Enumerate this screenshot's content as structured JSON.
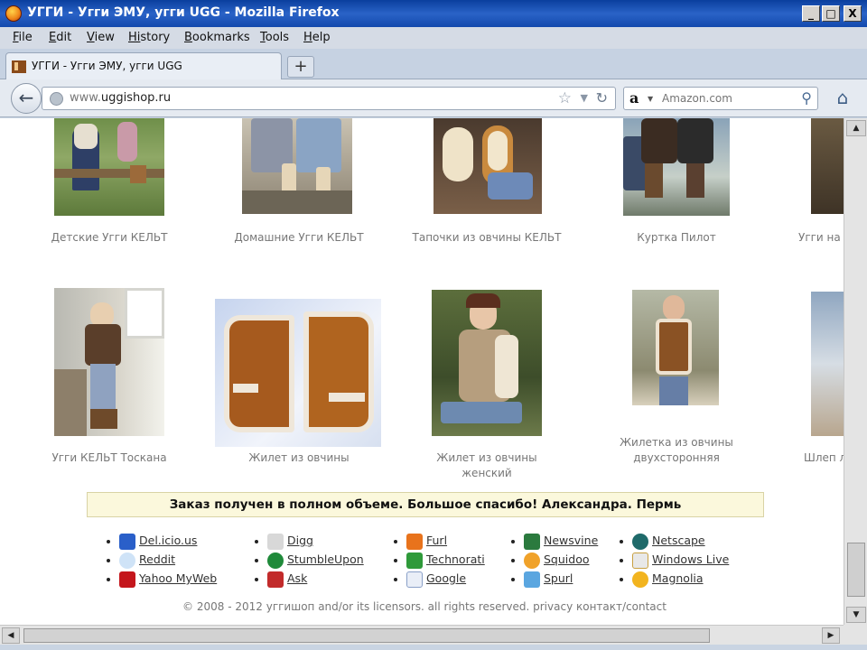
{
  "window": {
    "title": "УГГИ - Угги ЭМУ, угги UGG - Mozilla Firefox",
    "controls": [
      "_",
      "□",
      "X"
    ]
  },
  "menu": [
    {
      "key": "F",
      "rest": "ile"
    },
    {
      "key": "E",
      "rest": "dit"
    },
    {
      "key": "V",
      "rest": "iew"
    },
    {
      "key": "Hi",
      "rest": "story"
    },
    {
      "key": "B",
      "rest": "ookmarks"
    },
    {
      "key": "T",
      "rest": "ools"
    },
    {
      "key": "H",
      "rest": "elp"
    }
  ],
  "tab": {
    "label": "УГГИ - Угги ЭМУ, угги UGG",
    "new_tab": "+"
  },
  "nav": {
    "url_prefix": "www.",
    "url_domain": "uggishop.ru",
    "search_placeholder": "Amazon.com",
    "search_engine_glyph": "a"
  },
  "products_row1": [
    {
      "caption": "Детские Угги КЕЛЬТ"
    },
    {
      "caption": "Домашние Угги КЕЛЬТ"
    },
    {
      "caption": "Тапочки из овчины КЕЛЬТ"
    },
    {
      "caption": "Куртка Пилот"
    },
    {
      "caption": "Угги на"
    }
  ],
  "products_row2": [
    {
      "caption": "Угги КЕЛЬТ Тоскана"
    },
    {
      "caption": "Жилет из овчины"
    },
    {
      "caption": "Жилет из овчины женский"
    },
    {
      "caption": "Жилетка из овчины двухсторонняя"
    },
    {
      "caption": "Шлеп л"
    }
  ],
  "testimonial": "Заказ получен в полном объеме. Большое спасибо! Александра. Пермь",
  "social_columns": [
    [
      {
        "label": "Del.icio.us",
        "icon": "delicious-icon",
        "color": "#2a5fc9"
      },
      {
        "label": "Reddit",
        "icon": "reddit-icon",
        "color": "#cfe3f7"
      },
      {
        "label": "Yahoo MyWeb",
        "icon": "yahoo-icon",
        "color": "#c4161c"
      }
    ],
    [
      {
        "label": "Digg",
        "icon": "digg-icon",
        "color": "#d8d8d8"
      },
      {
        "label": "StumbleUpon",
        "icon": "stumbleupon-icon",
        "color": "#1f8a3a"
      },
      {
        "label": "Ask",
        "icon": "ask-icon",
        "color": "#c22b2b"
      }
    ],
    [
      {
        "label": "Furl",
        "icon": "furl-icon",
        "color": "#e8731c"
      },
      {
        "label": "Technorati",
        "icon": "technorati-icon",
        "color": "#2f9a3a"
      },
      {
        "label": "Google",
        "icon": "google-icon",
        "color": "#e9eef7"
      }
    ],
    [
      {
        "label": "Newsvine",
        "icon": "newsvine-icon",
        "color": "#2b7a3e"
      },
      {
        "label": "Squidoo",
        "icon": "squidoo-icon",
        "color": "#f0a22a"
      },
      {
        "label": "Spurl",
        "icon": "spurl-icon",
        "color": "#5aa6e0"
      }
    ],
    [
      {
        "label": "Netscape",
        "icon": "netscape-icon",
        "color": "#1f6a6a"
      },
      {
        "label": "Windows Live",
        "icon": "windows-live-icon",
        "color": "#e8e8e8"
      },
      {
        "label": "Magnolia",
        "icon": "magnolia-icon",
        "color": "#f2b41f"
      }
    ]
  ],
  "footer": "© 2008 - 2012 уггишоп and/or its licensors. all rights reserved. privacy контакт/contact"
}
